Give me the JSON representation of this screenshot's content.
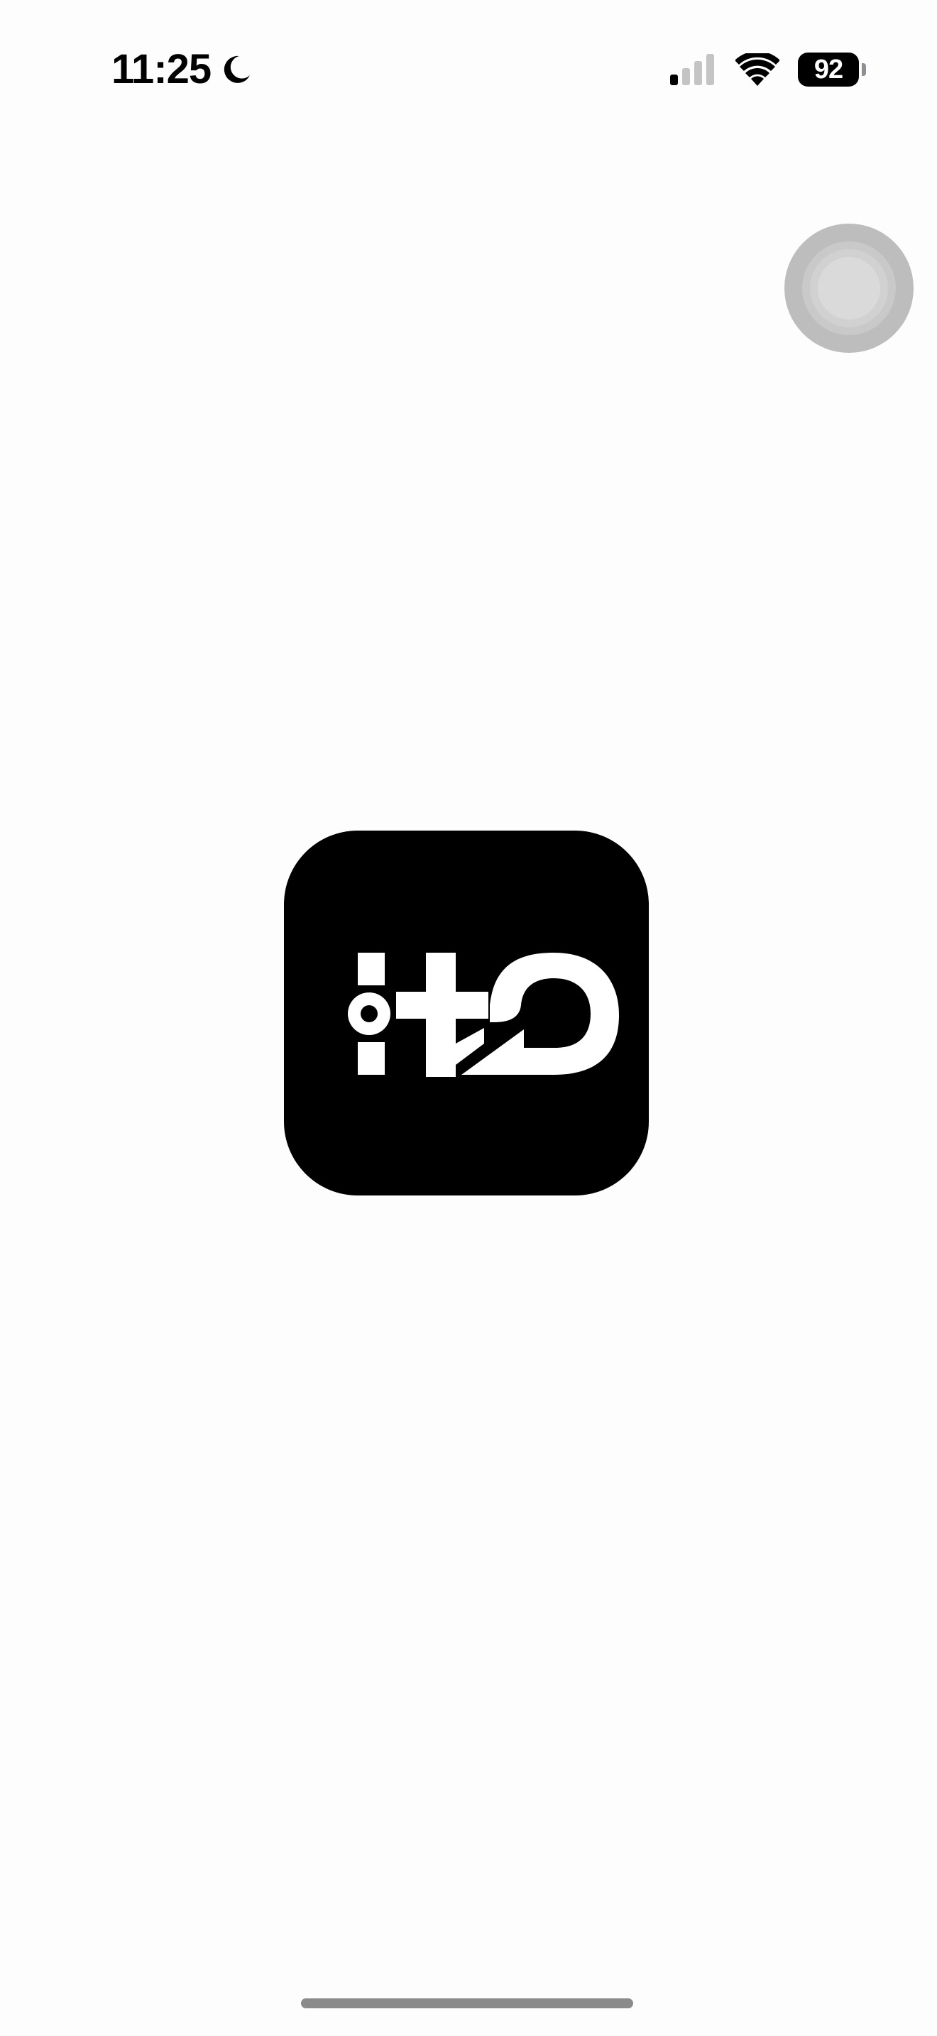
{
  "status_bar": {
    "time": "11:25",
    "focus_icon": "moon-icon",
    "signal_icon": "cellular-signal-icon",
    "signal_bars_active": 1,
    "signal_bars_total": 4,
    "wifi_icon": "wifi-icon",
    "battery_level": "92",
    "battery_icon": "battery-icon"
  },
  "assistive_touch": {
    "icon": "assistive-touch-icon"
  },
  "app_logo": {
    "icon": "app-logo-icon",
    "background_color": "#000000",
    "mark_color": "#ffffff"
  },
  "home_indicator": {
    "color": "#8a8a8a"
  }
}
